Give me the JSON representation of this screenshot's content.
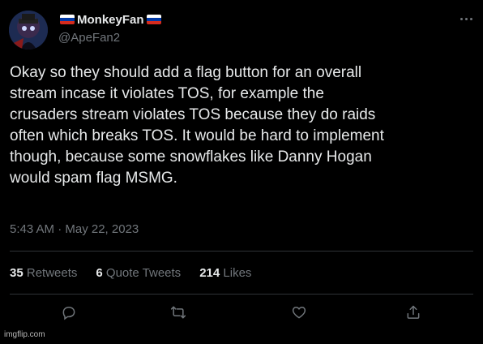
{
  "author": {
    "flag_left": "🇷🇺",
    "display_name": "MonkeyFan",
    "flag_right": "🇷🇺",
    "handle": "@ApeFan2",
    "avatar": "avatar-image"
  },
  "tweet": {
    "lines": [
      "Okay so they should add a flag button for an overall",
      "stream incase it violates TOS, for example the",
      "crusaders stream violates TOS because they do raids",
      "often which breaks TOS. It would be hard to implement",
      "though, because some snowflakes like Danny Hogan",
      "would spam flag MSMG."
    ],
    "timestamp": "5:43 AM · May 22, 2023"
  },
  "stats": {
    "retweets_count": "35",
    "retweets_label": "Retweets",
    "quotes_count": "6",
    "quotes_label": "Quote Tweets",
    "likes_count": "214",
    "likes_label": "Likes"
  },
  "actions": {
    "reply": "reply-icon",
    "retweet": "retweet-icon",
    "like": "heart-icon",
    "share": "share-icon"
  },
  "watermark": "imgflip.com",
  "colors": {
    "background": "#000000",
    "text": "#e7e9ea",
    "secondary": "#71767b",
    "divider": "#2f3336"
  }
}
